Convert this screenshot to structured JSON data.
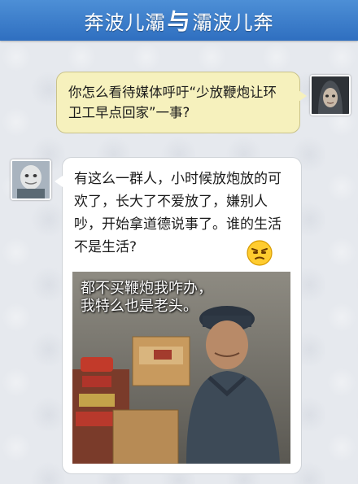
{
  "header": {
    "title_left": "奔波儿灞",
    "title_mid": "与",
    "title_right": "灞波儿奔"
  },
  "messages": [
    {
      "side": "right",
      "text": "你怎么看待媒体呼吁“少放鞭炮让环卫工早点回家”一事?"
    },
    {
      "side": "left",
      "text": "有这么一群人，小时候放炮放的可欢了，长大了不爱放了，嫌别人吵，开始拿道德说事了。谁的生活不是生活?",
      "image_caption_line1": "都不买鞭炮我咋办，",
      "image_caption_line2": "我特么也是老头。"
    }
  ],
  "icons": {
    "emoji": "annoyed-face-icon",
    "avatar_right": "avatar-dark-hooded",
    "avatar_left": "avatar-grey-puppet"
  },
  "colors": {
    "header": "#3b7ccb",
    "right_bubble": "#f6f1bd",
    "left_bubble": "#ffffff",
    "background": "#e6e9ee"
  }
}
